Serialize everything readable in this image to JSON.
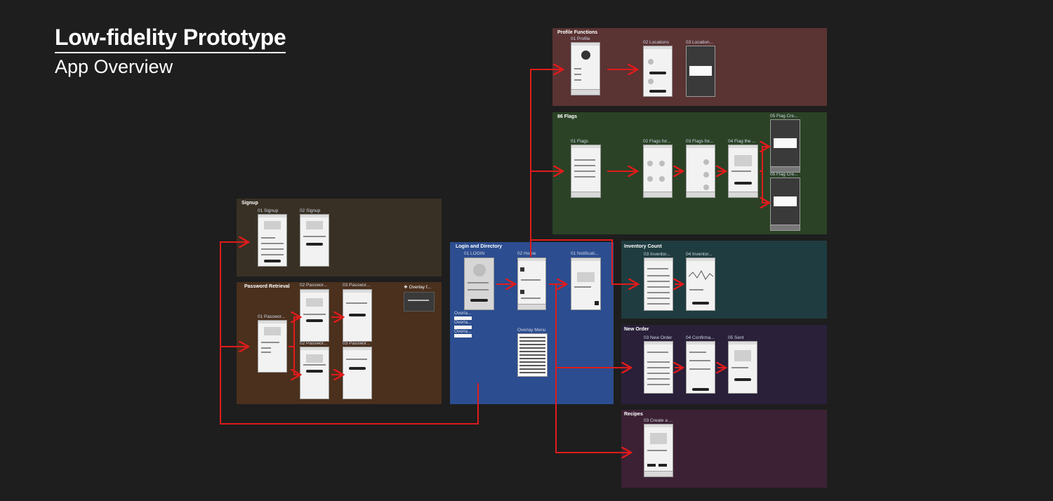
{
  "header": {
    "title": "Low-fidelity Prototype",
    "subtitle": "App Overview"
  },
  "colors": {
    "background": "#1e1e1e",
    "arrow": "#e01b1b"
  },
  "sections": {
    "signup": {
      "title": "Signup",
      "screens": [
        "01 Signup",
        "02 Signup"
      ]
    },
    "password": {
      "title": "Password Retrieval",
      "screens": [
        "01 Passwor...",
        "02 Passwor...",
        "03 Passwor...",
        "02 Passwor...",
        "03 Passwor..."
      ],
      "overlay": "Overlay f..."
    },
    "login": {
      "title": "Login and Directory",
      "screens": [
        "01 LOGIN",
        "02 Home",
        "01 Notificati..."
      ],
      "overlays": [
        "Overla...",
        "Overla...",
        "Overla..."
      ],
      "overlay_menu": "Overlay Menu"
    },
    "profile": {
      "title": "Profile Functions",
      "screens": [
        "01 Profile",
        "02 Locations",
        "03 Location..."
      ]
    },
    "flags": {
      "title": "86 Flags",
      "screens": [
        "01 Flags",
        "02 Flags for...",
        "03 Flags for...",
        "04 Flag the ...",
        "05 Flag Cre...",
        "05 Flag Cre..."
      ]
    },
    "inventory": {
      "title": "Inventory Count",
      "screens": [
        "03 Inventor...",
        "04 Inventor..."
      ]
    },
    "order": {
      "title": "New Order",
      "screens": [
        "03 New Order",
        "04 Confirma...",
        "05 Sent"
      ]
    },
    "recipes": {
      "title": "Recipes",
      "screens": [
        "03 Create a ..."
      ]
    }
  }
}
